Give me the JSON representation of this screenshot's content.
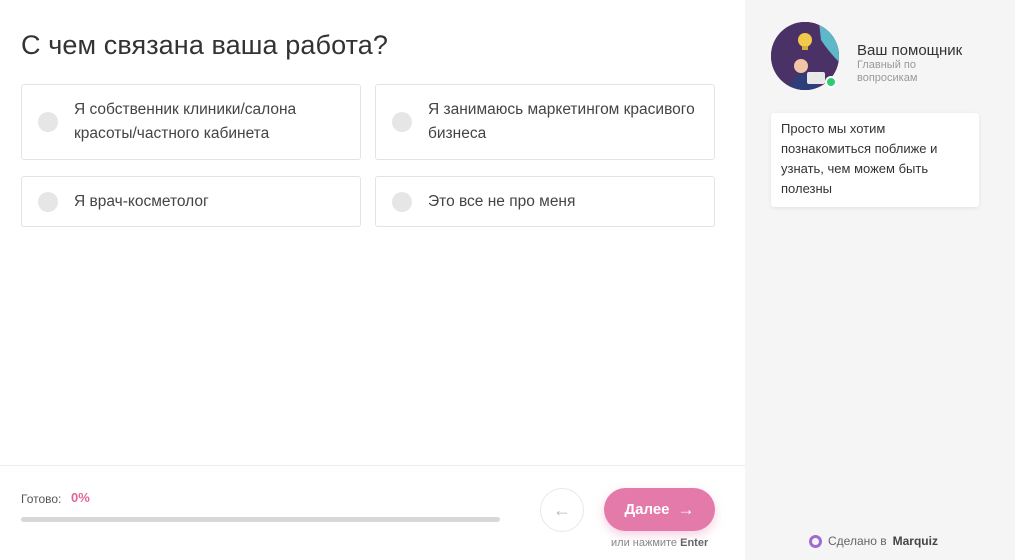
{
  "question": {
    "title": "С чем связана ваша работа?"
  },
  "options": [
    {
      "label": "Я собственник клиники/салона красоты/частного кабинета"
    },
    {
      "label": "Я занимаюсь маркетингом красивого бизнеса"
    },
    {
      "label": "Я врач-косметолог"
    },
    {
      "label": "Это все не про меня"
    }
  ],
  "progress": {
    "label": "Готово:",
    "value_text": "0%",
    "fraction": 0
  },
  "nav": {
    "back_icon": "←",
    "next_label": "Далее",
    "next_icon": "→",
    "enter_hint_prefix": "или нажмите",
    "enter_hint_key": "Enter"
  },
  "assistant": {
    "name": "Ваш помощник",
    "role": "Главный по вопросикам",
    "message": "Просто мы хотим познакомиться поближе и узнать, чем можем быть полезны"
  },
  "branding": {
    "made_with_prefix": "Сделано в",
    "made_with_brand": "Marquiz"
  },
  "colors": {
    "accent": "#e37aa9",
    "progress_text": "#e0669a",
    "online": "#2ecc71",
    "sidebar_bg": "#f5f5f5"
  }
}
